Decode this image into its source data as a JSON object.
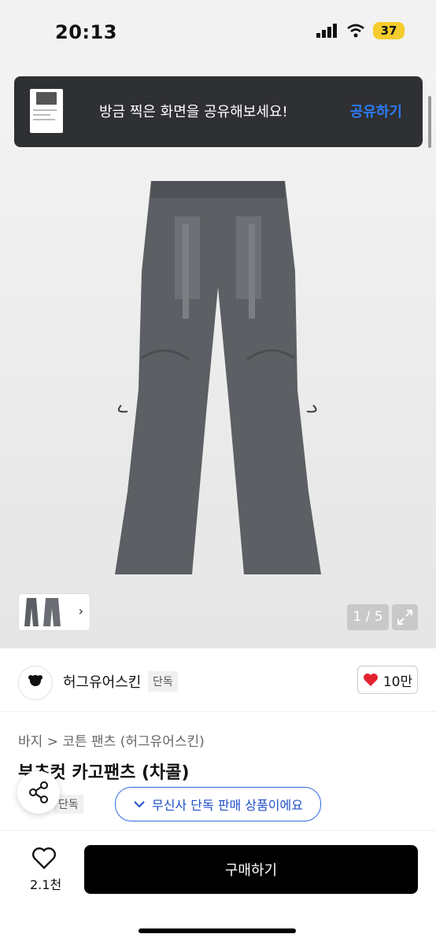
{
  "status": {
    "time": "20:13",
    "battery": "37"
  },
  "toast": {
    "message": "방금 찍은 화면을 공유해보세요!",
    "action": "공유하기"
  },
  "gallery": {
    "counter": "1 / 5"
  },
  "brand": {
    "name": "허그유어스킨",
    "tag": "단독",
    "likes": "10만"
  },
  "product": {
    "breadcrumb": [
      "바지",
      "코튼 팬츠 (허그유어스킨)"
    ],
    "title": "부츠컷 카고팬츠 (차콜)",
    "sub_tag": "단독",
    "exclusive_notice": "무신사 단독 판매 상품이에요"
  },
  "bottom": {
    "wishlist_count": "2.1천",
    "buy_label": "구매하기"
  },
  "colors": {
    "accent": "#2b7bf3",
    "toast_bg": "#2f3033",
    "like_red": "#e3222f",
    "pill_blue": "#1f4fc7"
  }
}
